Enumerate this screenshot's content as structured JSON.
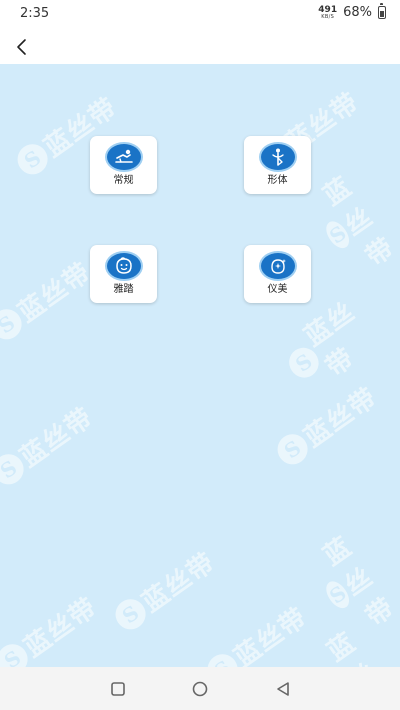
{
  "status_bar": {
    "time": "2:35",
    "net_speed_value": "491",
    "net_speed_unit": "KB/S",
    "battery_percent": "68%"
  },
  "header": {
    "back_icon": "chevron-left-icon"
  },
  "watermark": {
    "logo_letter": "S",
    "text": "蓝丝带"
  },
  "tiles": [
    {
      "label": "常规",
      "icon": "person-exercise-icon"
    },
    {
      "label": "形体",
      "icon": "body-shape-icon"
    },
    {
      "label": "雅踏",
      "icon": "baby-face-icon"
    },
    {
      "label": "仪美",
      "icon": "sparkle-face-icon"
    }
  ],
  "nav_bar": {
    "buttons": [
      "recents-square-icon",
      "home-circle-icon",
      "back-triangle-icon"
    ]
  },
  "colors": {
    "content_background": "#d2ebfa",
    "icon_blue": "#1a73c6",
    "icon_ring": "#9fcff2",
    "nav_background": "#f4f4f4"
  }
}
